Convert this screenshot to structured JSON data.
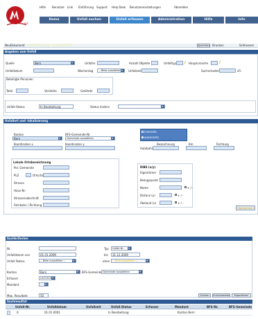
{
  "header": {
    "links": [
      "Hilfe",
      "Benutzer",
      "Link",
      "Einführung",
      "Support",
      "Help Desk",
      "Benutzereinstellungen",
      "Abmelden"
    ],
    "logo_text": "vis",
    "tabs": [
      "Home",
      "Unfall suchen",
      "Unfall erfassen",
      "Administration",
      "Hilfe",
      "Info"
    ],
    "active_tab": 2
  },
  "toolbar": {
    "left": [
      "Neu",
      "Dokument"
    ],
    "crumb_hidden": "Unfallerfassung - Unfallprotokoll",
    "buttons": [
      "Speichern",
      "Drucken",
      "Schliessen"
    ]
  },
  "section1": {
    "title": "Angaben zum Unfall",
    "quelle_label": "Quelle",
    "quelle_value": "Bern",
    "unfallnr_label": "Unfallnr.",
    "anzahl_label": "Anzahl Objekte",
    "unfalltyp_label": "Unfalltyp",
    "hauptursache_label": "Hauptursache",
    "unfalldatum_label": "Unfalldatum",
    "wochentag_label": "Wochentag",
    "wochentag_value": "-- Bitte auswählen --",
    "unfallzeit_label": "Unfallzeit",
    "sachschaden_label": "Sachschaden",
    "currency": "sFr.",
    "beteiligte_label": "Beteiligte Personen",
    "total_label": "Total",
    "verletzte_label": "Verletzte",
    "getoetete_label": "Getötete",
    "status_label": "Unfall-Status",
    "status_value": "In Bearbeitung",
    "status_aendern_label": "Status ändern"
  },
  "section2": {
    "title": "Unfallort und -lokalisierung",
    "kanton_label": "Kanton",
    "kanton_value": "Bern",
    "bfs_label": "BFS-Gemeinde-Nr.",
    "bfs_value": "Gemeinde auswählen",
    "innerorts": "innerorts",
    "ausserorts": "ausserorts",
    "koordx_label": "Koordinaten x",
    "koordy_label": "Koordinaten y",
    "autobahn_label": "Autobahn",
    "bezeichnung_label": "Bezeichnung",
    "km_label": "Km",
    "richtung_label": "Richtung",
    "lokale_title": "Lokale Ortsbezeichnung",
    "pol_gemeinde": "Pol. Gemeinde",
    "plz": "PLZ",
    "ortschaft": "Ortschaft",
    "strasse": "Strasse",
    "hausnr": "Haus-Nr.",
    "strassenabschnitt": "Strassenabschnitt",
    "fahrbahn": "Fahrbahn / Richtung",
    "ribs_title": "RIBS (x/y)",
    "eigentuemer": "Eigentümer",
    "bezugspunkt": "Bezugspunkt",
    "name": "Name",
    "distanz": "Distanz (u)",
    "abstand": "Abstand (v)",
    "plus_minus": "+ / -",
    "uebernehmen": "Übernehmen"
  },
  "search": {
    "title": "Suchkriterien",
    "nr_label": "Nr.",
    "typ_label": "Typ",
    "typ_value": "Unfall-Nr.",
    "datum_von_label": "Unfalldatum von",
    "datum_von": "01.01.2009",
    "bis_label": "bis",
    "datum_bis": "31.12.2009",
    "status_label": "Unfall Status",
    "status_value": "-- Bitte auswählen --",
    "ohne_label": "ohne",
    "ohne_value": "-- Bitte auswählen --",
    "kanton_label": "Kanton",
    "kanton_value": "Bern",
    "bfs_label": "BFS-Gemeinde",
    "bfs_value": "Gemeinde auswählen",
    "erfasser_label": "Erfasser",
    "erfasser_value": "LeO2325",
    "mandant_label": "Mandant",
    "mandant_value": "",
    "max_label": "Max. Resultate",
    "max_value": "50",
    "buttons": [
      "Suchen",
      "Zurücksetzen",
      "Exportieren"
    ]
  },
  "results": {
    "title": "Suchresultat",
    "columns": [
      "Unfall-Nr.",
      "Unfalldatum",
      "Unfallzeit",
      "Unfall-Status",
      "Erfasser",
      "Mandant",
      "BFS-Nr.",
      "BFS-Gemeinde"
    ],
    "rows": [
      [
        "0",
        "01.01.0001",
        "",
        "In Bearbeitung",
        "",
        "Kanton Bern",
        "",
        ""
      ]
    ]
  },
  "colors": {
    "nav_bg": "#42638f",
    "nav_active": "#3d86cc",
    "section_bar": "#2d5a93",
    "input_fill": "#d8e6f6",
    "logo_red": "#c0161e"
  }
}
